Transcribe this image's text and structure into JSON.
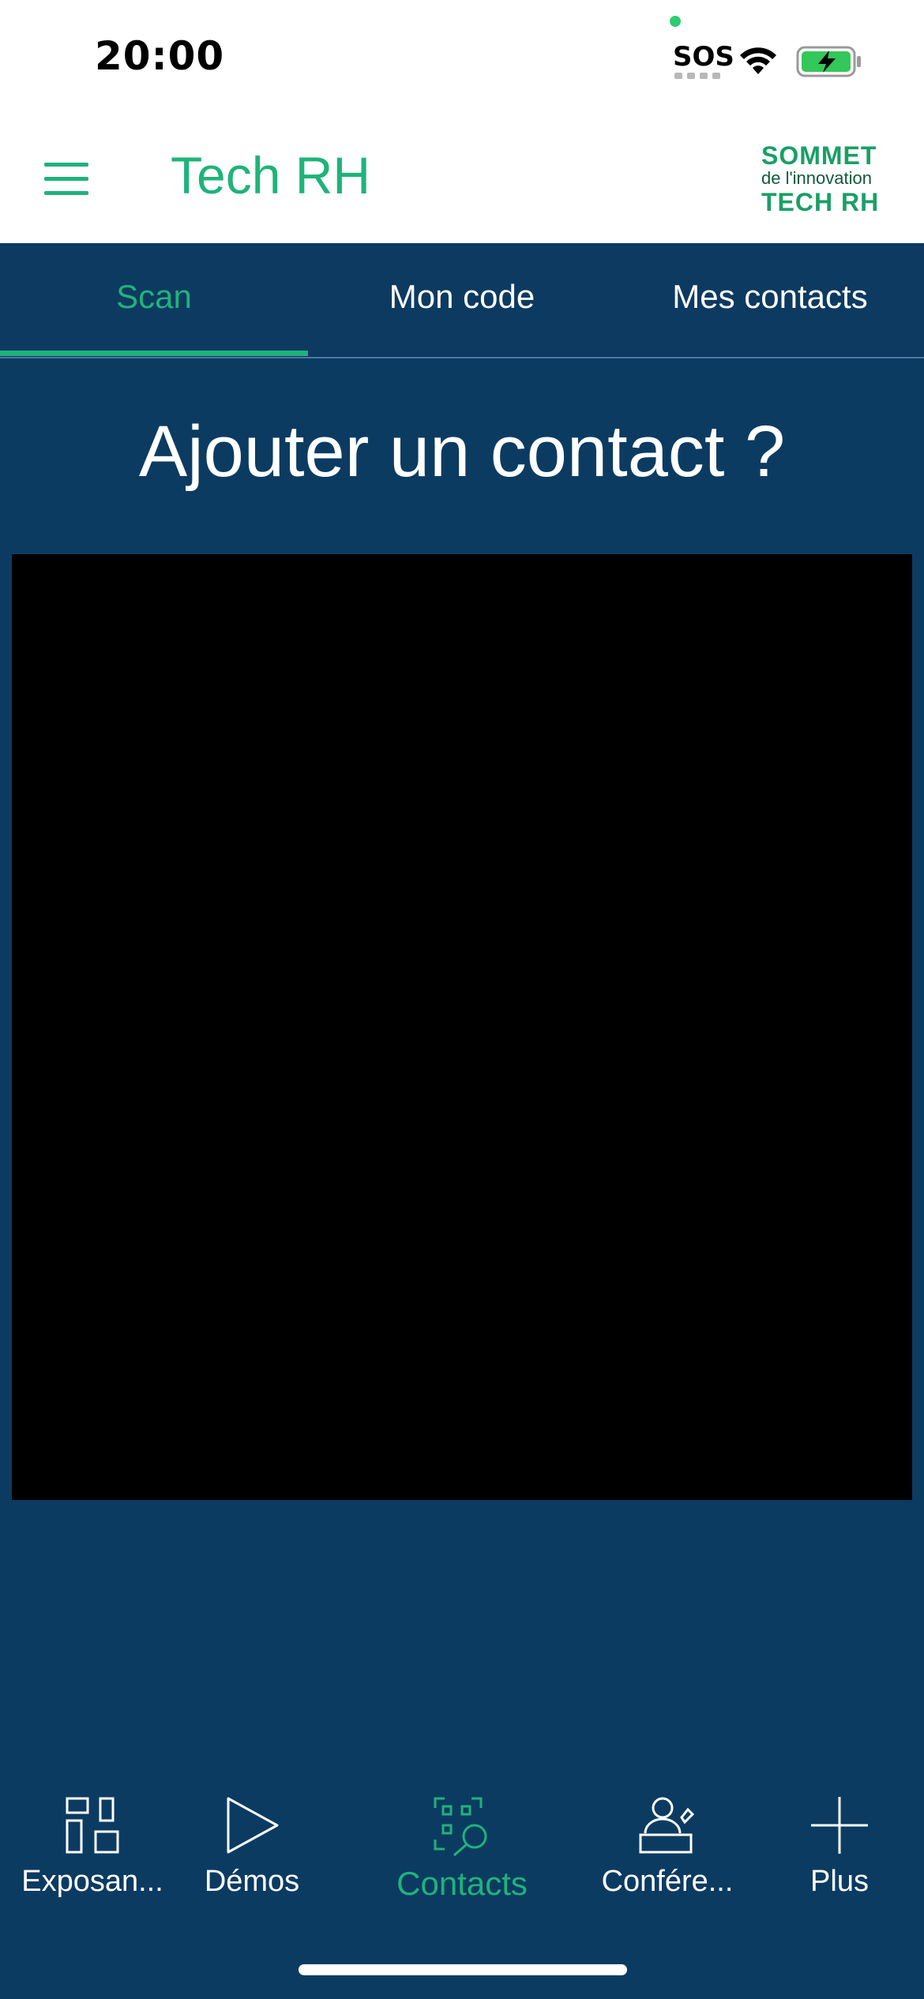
{
  "status_bar": {
    "time": "20:00",
    "sos": "SOS",
    "icons": [
      "green-dot-indicator",
      "wifi-icon",
      "battery-charging-icon"
    ],
    "battery_color": "#34c759"
  },
  "header": {
    "title": "Tech RH",
    "menu_icon": "hamburger-menu-icon",
    "logo": {
      "line1": "SOMMET",
      "line2": "de l'innovation",
      "line3": "TECH RH"
    }
  },
  "tabs": [
    {
      "label": "Scan",
      "active": true
    },
    {
      "label": "Mon code",
      "active": false
    },
    {
      "label": "Mes contacts",
      "active": false
    }
  ],
  "main": {
    "headline": "Ajouter un contact ?"
  },
  "bottom_nav": [
    {
      "label": "Exposan...",
      "icon": "grid-icon",
      "active": false
    },
    {
      "label": "Démos",
      "icon": "play-icon",
      "active": false
    },
    {
      "label": "Contacts",
      "icon": "qr-scan-icon",
      "active": true
    },
    {
      "label": "Confére...",
      "icon": "speaker-icon",
      "active": false
    },
    {
      "label": "Plus",
      "icon": "plus-icon",
      "active": false
    }
  ],
  "colors": {
    "accent": "#1fb37a",
    "navy": "#0c3b62",
    "white": "#ffffff"
  }
}
